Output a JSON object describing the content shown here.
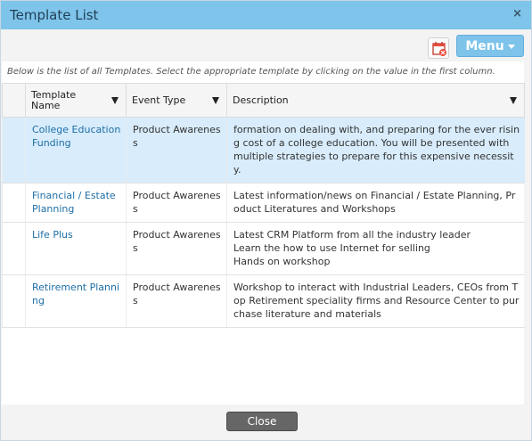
{
  "dialog": {
    "title": "Template List",
    "close_symbol": "×"
  },
  "toolbar": {
    "menu_label": "Menu",
    "icon": "calendar-remove-icon"
  },
  "instructions": "Below is the list of all Templates. Select the appropriate template by clicking on the value in the first column.",
  "table": {
    "columns": [
      "Template Name",
      "Event Type",
      "Description"
    ],
    "rows": [
      {
        "name": "College Education Funding",
        "event_type": "Product Awareness",
        "description": "formation on dealing with, and preparing for the ever rising cost of a college education. You will be presented with multiple strategies to prepare for this expensive necessity.",
        "selected": true
      },
      {
        "name": "Financial / Estate Planning",
        "event_type": "Product Awareness",
        "description": "Latest information/news on Financial / Estate Planning, Product Literatures and Workshops",
        "selected": false
      },
      {
        "name": "Life Plus",
        "event_type": "Product Awareness",
        "description_lines": [
          "Latest CRM Platform from all the industry leader",
          "Learn the how to use Internet for selling",
          "Hands on workshop"
        ],
        "selected": false
      },
      {
        "name": "Retirement Planning",
        "event_type": "Product Awareness",
        "description": "Workshop to interact with Industrial Leaders, CEOs from Top Retirement speciality firms and Resource Center to purchase literature and materials",
        "selected": false
      }
    ]
  },
  "footer": {
    "close_label": "Close"
  },
  "colors": {
    "titlebar": "#7fc4ea",
    "menu_button": "#7ec3ea",
    "selected_row": "#d8ecfb",
    "link": "#1e6ea6"
  }
}
